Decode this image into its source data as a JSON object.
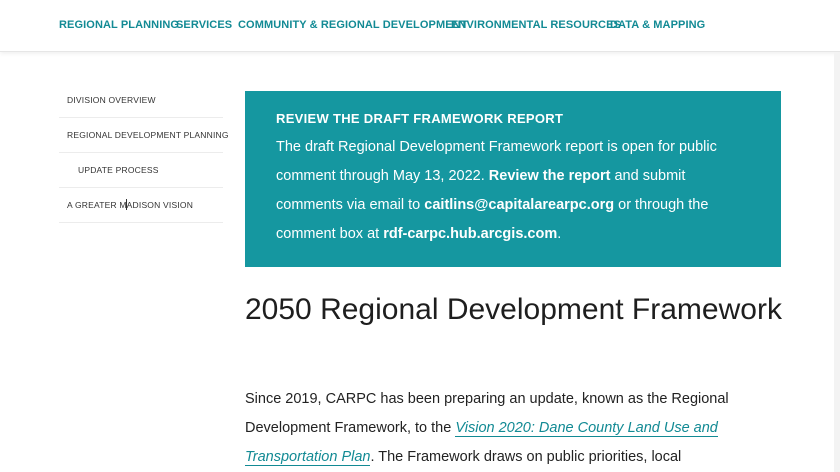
{
  "nav": {
    "items": [
      {
        "label": "REGIONAL PLANNING"
      },
      {
        "label": "SERVICES"
      },
      {
        "label": "COMMUNITY & REGIONAL DEVELOPMENT"
      },
      {
        "label": "ENVIRONMENTAL RESOURCES"
      },
      {
        "label": "DATA & MAPPING"
      }
    ]
  },
  "sidebar": {
    "items": [
      {
        "label": "DIVISION OVERVIEW"
      },
      {
        "label": "REGIONAL DEVELOPMENT PLANNING"
      },
      {
        "label": "UPDATE PROCESS"
      },
      {
        "label_before": "A GREATER M",
        "label_after": "ADISON VISION"
      }
    ]
  },
  "banner": {
    "title": "REVIEW THE DRAFT FRAMEWORK REPORT",
    "text1": "The draft Regional Development Framework report is open for public comment through May 13, 2022. ",
    "link_report": "Review the report",
    "text2": " and submit comments via email to ",
    "email": "caitlins@capitalarearpc.org",
    "text3": " or through the comment box at ",
    "site": "rdf-carpc.hub.arcgis.com",
    "text4": "."
  },
  "main": {
    "title": "2050 Regional Development Framework",
    "para1": "Since 2019, CARPC has been preparing an update, known as the Regional Development Framework, to the ",
    "link_vision": "Vision 2020: Dane County Land Use and Transportation Plan",
    "para2": ". The Framework draws on public priorities, local"
  },
  "colors": {
    "accent": "#1597a0",
    "nav_text": "#128a94"
  }
}
